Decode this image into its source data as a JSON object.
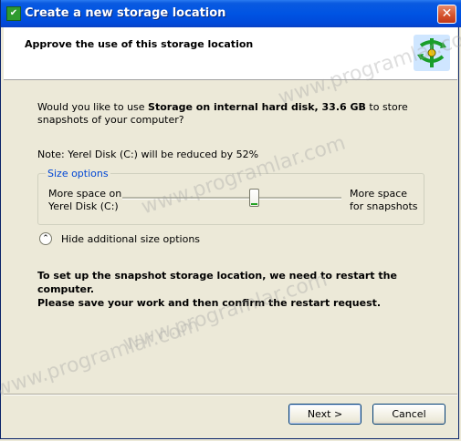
{
  "window": {
    "title": "Create a new storage location",
    "close_glyph": "✕"
  },
  "header": {
    "title": "Approve the use of this storage location",
    "icon": "storage-sync-icon"
  },
  "question": {
    "prefix": "Would you like to use ",
    "storage_name": "Storage on internal hard disk, 33.6 GB",
    "suffix": " to store snapshots of your computer?"
  },
  "note": "Note: Yerel Disk (C:) will be reduced by 52%",
  "size_options": {
    "legend": "Size options",
    "left_label_1": "More space on",
    "left_label_2": "Yerel Disk (C:)",
    "right_label_1": "More space",
    "right_label_2": "for snapshots",
    "slider_percent": 60
  },
  "toggle": {
    "label": "Hide additional size options"
  },
  "restart": {
    "line1": "To set up the snapshot storage location, we need to restart the computer.",
    "line2": "Please save your work and then confirm the restart request."
  },
  "buttons": {
    "next": "Next >",
    "cancel": "Cancel"
  },
  "watermark": "www.programlar.com"
}
